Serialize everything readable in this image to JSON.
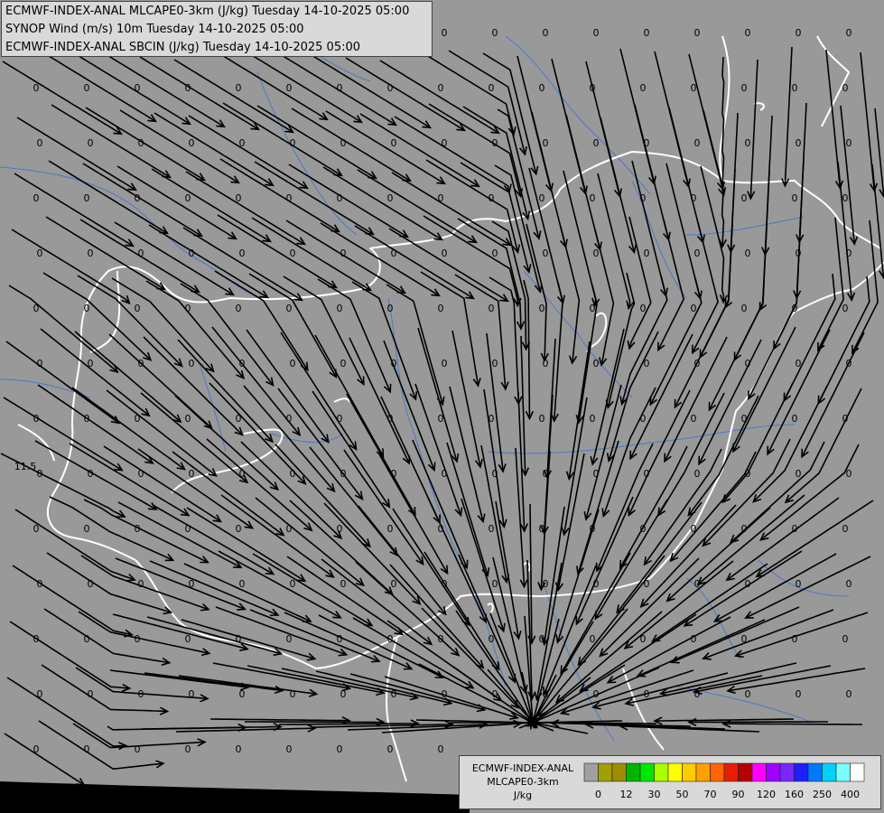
{
  "title_lines": [
    "ECMWF-INDEX-ANAL MLCAPE0-3km (J/kg) Tuesday 14-10-2025 05:00",
    "SYNOP Wind (m/s) 10m Tuesday 14-10-2025 05:00",
    "ECMWF-INDEX-ANAL SBCIN (J/kg) Tuesday 14-10-2025 05:00"
  ],
  "legend": {
    "title_lines": [
      "ECMWF-INDEX-ANAL",
      "MLCAPE0-3km",
      "J/kg"
    ],
    "swatches": [
      "#a0a0a0",
      "#a0a000",
      "#a08c00",
      "#00b400",
      "#00e600",
      "#aaff00",
      "#ffff00",
      "#ffcc00",
      "#ffa000",
      "#ff6400",
      "#e61e00",
      "#b40000",
      "#ff00ff",
      "#a000ff",
      "#7828ff",
      "#1e1eff",
      "#0078ff",
      "#00d2ff",
      "#78ffff",
      "#ffffff"
    ],
    "tick_labels": [
      "0",
      "12",
      "30",
      "50",
      "70",
      "90",
      "120",
      "160",
      "250",
      "400"
    ]
  },
  "grid_value": "0",
  "special_value": "11.5",
  "colors": {
    "background": "#999999",
    "border": "#ffffff",
    "river": "#4a78c8",
    "streamline": "#000000"
  }
}
